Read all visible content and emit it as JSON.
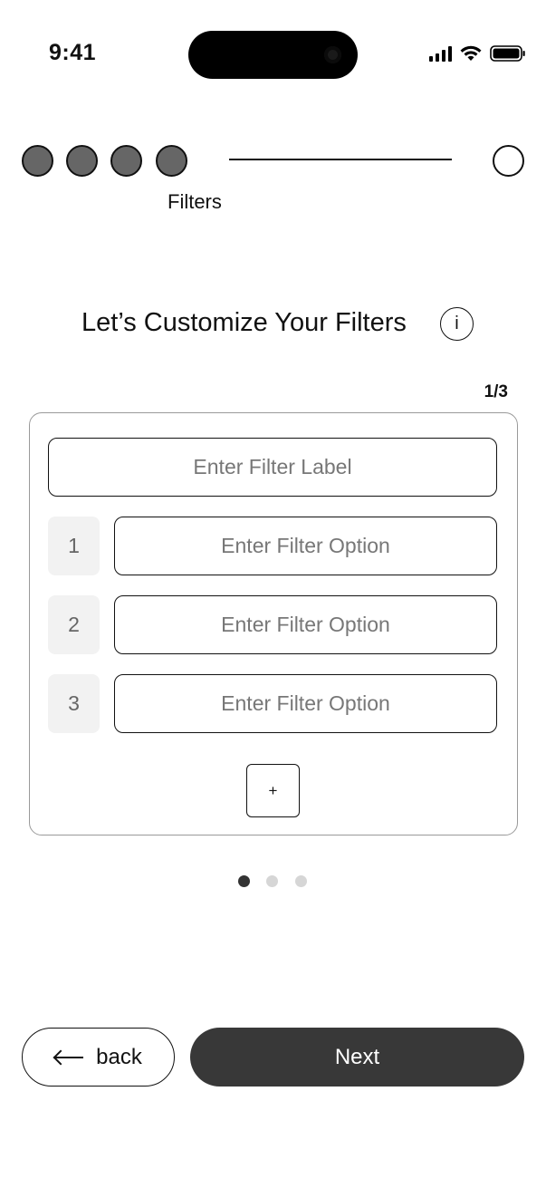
{
  "status_bar": {
    "time": "9:41",
    "icons": [
      "signal-icon",
      "wifi-icon",
      "battery-icon"
    ]
  },
  "stepper": {
    "completed_steps": 4,
    "total_steps": 5,
    "current_label": "Filters"
  },
  "main": {
    "heading": "Let’s Customize Your Filters",
    "info_icon_text": "i",
    "pager": "1/3"
  },
  "card": {
    "label_placeholder": "Enter Filter Label",
    "options": [
      {
        "number": "1",
        "placeholder": "Enter Filter Option"
      },
      {
        "number": "2",
        "placeholder": "Enter Filter Option"
      },
      {
        "number": "3",
        "placeholder": "Enter Filter Option"
      }
    ],
    "add_label": "+"
  },
  "carousel": {
    "count": 3,
    "active_index": 0
  },
  "footer": {
    "back_label": "back",
    "next_label": "Next"
  },
  "colors": {
    "step_fill": "#666666",
    "primary_button": "#383838",
    "placeholder_text": "#777777",
    "active_dot": "#333333",
    "inactive_dot": "#d6d6d6"
  }
}
